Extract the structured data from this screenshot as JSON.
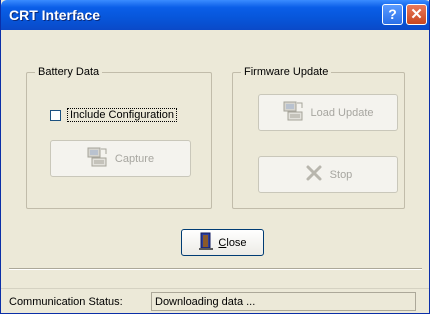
{
  "window": {
    "title": "CRT Interface",
    "help_glyph": "?",
    "close_glyph": "✕"
  },
  "battery_data": {
    "legend": "Battery Data",
    "include_configuration": {
      "label": "Include Configuration",
      "checked": false
    },
    "capture_label": "Capture"
  },
  "firmware_update": {
    "legend": "Firmware Update",
    "load_update_label": "Load Update",
    "stop_label": "Stop"
  },
  "close_button": {
    "mnemonic": "C",
    "rest": "lose"
  },
  "status": {
    "label": "Communication Status:",
    "value": "Downloading data ..."
  },
  "icons": {
    "capture": "computer-download-icon",
    "load_update": "computer-download-icon",
    "stop": "cancel-x-icon",
    "close": "door-exit-icon"
  }
}
